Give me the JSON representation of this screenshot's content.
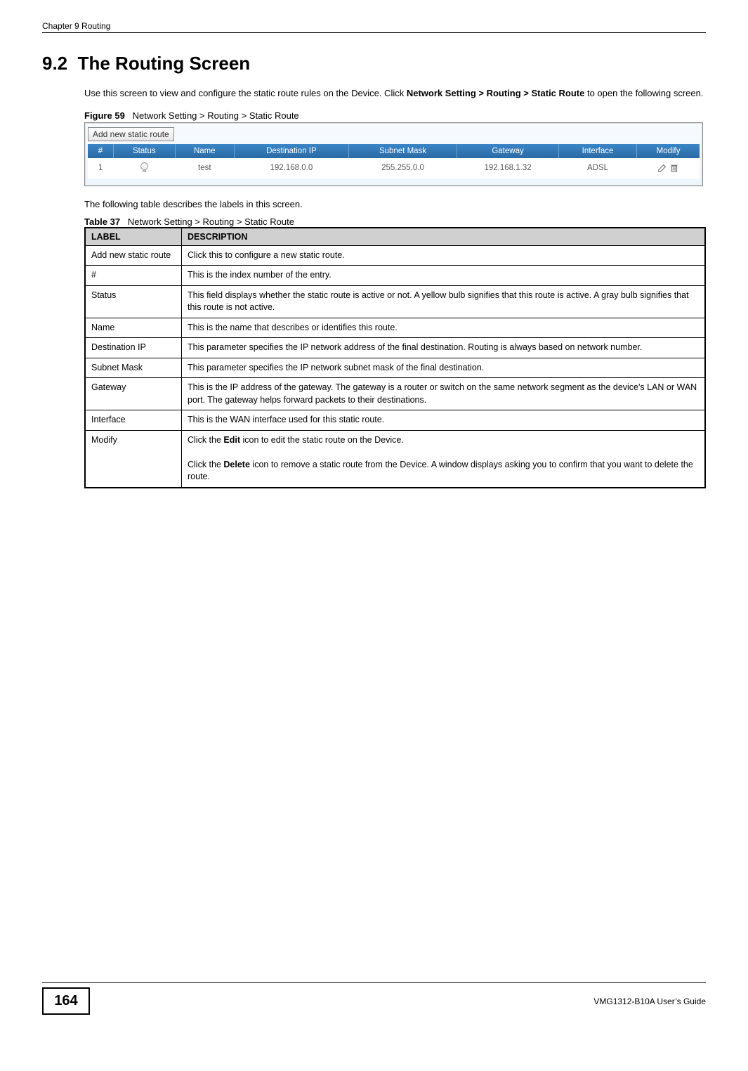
{
  "header": {
    "chapter": "Chapter 9 Routing"
  },
  "section": {
    "number": "9.2",
    "title": "The Routing Screen"
  },
  "intro": {
    "text_pre": "Use this screen to view and configure the static route rules on the Device. Click ",
    "bold1": "Network Setting > Routing > Static Route",
    "text_post": " to open the following screen."
  },
  "figure": {
    "label": "Figure 59",
    "caption": "Network Setting > Routing > Static Route"
  },
  "screenshot": {
    "add_button": "Add new static route",
    "columns": {
      "num": "#",
      "status": "Status",
      "name": "Name",
      "dest": "Destination IP",
      "mask": "Subnet Mask",
      "gw": "Gateway",
      "iface": "Interface",
      "modify": "Modify"
    },
    "row": {
      "num": "1",
      "name": "test",
      "dest": "192.168.0.0",
      "mask": "255.255.0.0",
      "gw": "192.168.1.32",
      "iface": "ADSL"
    }
  },
  "after_figure_text": "The following table describes the labels in this screen.",
  "table": {
    "label": "Table 37",
    "caption": "Network Setting > Routing > Static Route",
    "head_label": "LABEL",
    "head_desc": "DESCRIPTION",
    "rows": [
      {
        "label": "Add new static route",
        "desc": "Click this to configure a new static route."
      },
      {
        "label": "#",
        "desc": "This is the index number of the entry."
      },
      {
        "label": "Status",
        "desc": "This field displays whether the static route is active or not. A yellow bulb signifies that this route is active. A gray bulb signifies that this route is not active."
      },
      {
        "label": "Name",
        "desc": "This is the name that describes or identifies this route."
      },
      {
        "label": "Destination IP",
        "desc": "This parameter specifies the IP network address of the final destination. Routing is always based on network number."
      },
      {
        "label": "Subnet Mask",
        "desc": "This parameter specifies the IP network subnet mask of the final destination."
      },
      {
        "label": "Gateway",
        "desc": "This is the IP address of the gateway. The gateway is a router or switch on the same network segment as the device's LAN or WAN port. The gateway helps forward packets to their destinations."
      },
      {
        "label": "Interface",
        "desc": "This is the WAN interface used for this static route."
      }
    ],
    "modify_row": {
      "label": "Modify",
      "line1_pre": "Click the ",
      "line1_bold": "Edit",
      "line1_post": " icon to edit the static route on the Device.",
      "line2_pre": "Click the ",
      "line2_bold": "Delete",
      "line2_post": " icon to remove a static route from the Device. A window displays asking you to confirm that you want to delete the route."
    }
  },
  "footer": {
    "page": "164",
    "guide": "VMG1312-B10A User’s Guide"
  }
}
